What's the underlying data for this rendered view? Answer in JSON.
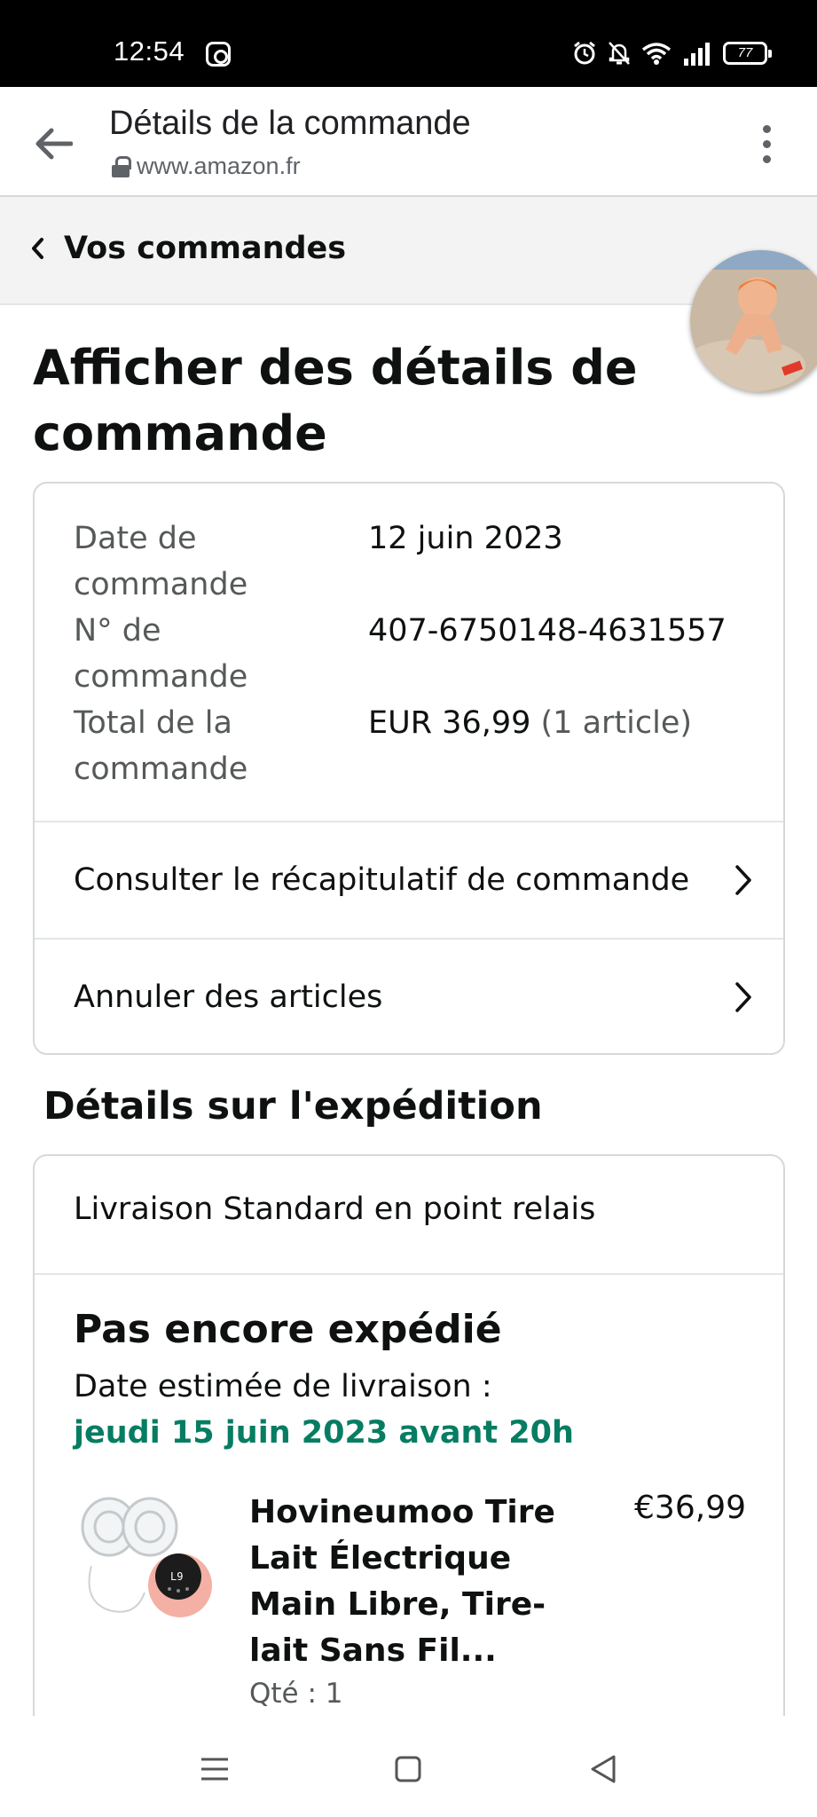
{
  "status_bar": {
    "time": "12:54",
    "battery": "77",
    "icons": [
      "instagram-icon",
      "alarm-icon",
      "bell-muted-icon",
      "wifi-icon",
      "signal-icon",
      "battery-icon"
    ]
  },
  "browser": {
    "title": "Détails de la commande",
    "url": "www.amazon.fr"
  },
  "breadcrumb": {
    "label": "Vos commandes"
  },
  "page": {
    "title": "Afficher des détails de commande"
  },
  "order": {
    "date_label": "Date de commande",
    "date_value": "12 juin 2023",
    "number_label": "N° de commande",
    "number_value": "407-6750148-4631557",
    "total_label": "Total de la commande",
    "total_value": "EUR 36,99",
    "total_count": "(1 article)",
    "summary_link": "Consulter le récapitulatif de commande",
    "cancel_link": "Annuler des articles"
  },
  "shipment": {
    "section_title": "Détails sur l'expédition",
    "method": "Livraison Standard en point relais",
    "status": "Pas encore expédié",
    "estimate_label": "Date estimée de livraison :",
    "estimate_date": "jeudi 15 juin 2023 avant 20h",
    "estimate_color": "#067d62"
  },
  "product": {
    "title": "Hovineumoo Tire Lait Électrique Main Libre, Tire-lait Sans Fil...",
    "price": "€36,99",
    "quantity": "Qté : 1"
  },
  "colors": {
    "status_bar_bg": "#000000",
    "breadcrumb_bg": "#f3f3f3",
    "card_border": "#d5d9d9",
    "muted_text": "#565959"
  }
}
